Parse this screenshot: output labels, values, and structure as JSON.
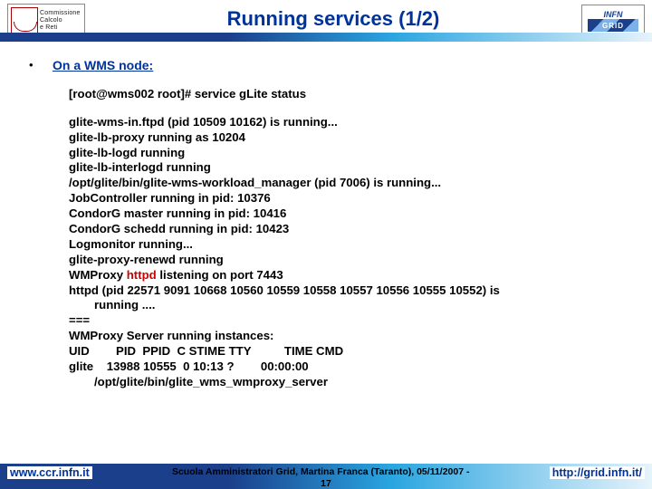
{
  "header": {
    "title": "Running services (1/2)",
    "logo_left_lines": [
      "Commissione",
      "Calcolo",
      "e Reti"
    ],
    "logo_right_top": "INFN",
    "logo_right_bot": "GRID"
  },
  "bullet": {
    "label": "On a WMS node:"
  },
  "terminal": {
    "command": "[root@wms002 root]# service gLite status",
    "lines": [
      "glite-wms-in.ftpd (pid 10509 10162) is running...",
      "glite-lb-proxy running as 10204",
      "glite-lb-logd running",
      "glite-lb-interlogd running",
      "/opt/glite/bin/glite-wms-workload_manager (pid 7006) is running...",
      "JobController running in pid: 10376",
      "CondorG master running in pid: 10416",
      "CondorG schedd running in pid: 10423",
      "Logmonitor running...",
      "glite-proxy-renewd running"
    ],
    "wmproxy_pre": "WMProxy ",
    "wmproxy_red": "httpd",
    "wmproxy_post": " listening on port 7443",
    "httpd_line": "httpd (pid 22571 9091 10668 10560 10559 10558 10557 10556 10555 10552) is",
    "httpd_sub": "running ....",
    "tail": [
      "===",
      "WMProxy Server running instances:",
      "UID        PID  PPID  C STIME TTY          TIME CMD",
      "glite    13988 10555  0 10:13 ?        00:00:00"
    ],
    "tail_sub": "/opt/glite/bin/glite_wms_wmproxy_server"
  },
  "footer": {
    "left": "www.ccr.infn.it",
    "center": "Scuola Amministratori Grid, Martina Franca (Taranto), 05/11/2007 -",
    "page": "17",
    "right": "http://grid.infn.it/"
  }
}
